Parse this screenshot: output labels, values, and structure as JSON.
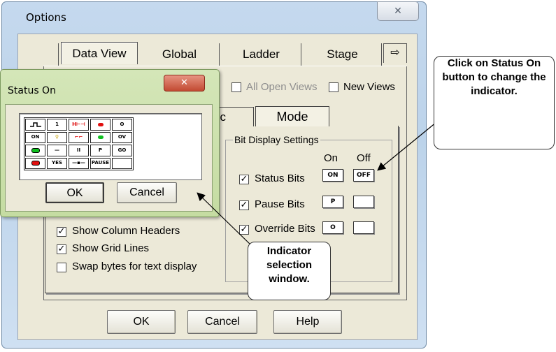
{
  "window": {
    "title": "Options",
    "close_glyph": "✕"
  },
  "tabs": [
    "Data View",
    "Global",
    "Ladder",
    "Stage"
  ],
  "tab_scroll_icon": "⇨",
  "sub_tabs": {
    "partial": "oc",
    "mode": "Mode"
  },
  "apply_to": {
    "all_open_views": "All Open Views",
    "new_views": "New Views"
  },
  "bit_display": {
    "title": "Bit Display Settings",
    "col_on": "On",
    "col_off": "Off",
    "rows": [
      {
        "label": "Status Bits",
        "on": "ON",
        "off": "OFF",
        "checked": true
      },
      {
        "label": "Pause Bits",
        "on": "P",
        "off": "",
        "checked": true
      },
      {
        "label": "Override Bits",
        "on": "O",
        "off": "",
        "checked": true
      }
    ]
  },
  "left_options": [
    {
      "label": "Show Column Headers",
      "checked": true
    },
    {
      "label": "Show Grid Lines",
      "checked": true
    },
    {
      "label": "Swap bytes for text display",
      "checked": false
    }
  ],
  "buttons": {
    "ok": "OK",
    "cancel": "Cancel",
    "help": "Help"
  },
  "status_popup": {
    "title": "Status On",
    "close_glyph": "✕",
    "ok": "OK",
    "cancel": "Cancel",
    "grid": [
      [
        "pulse-icon",
        "1",
        "⊢⊣",
        "red-dot",
        "O"
      ],
      [
        "ON",
        "bulb-icon",
        "switch-icon",
        "green-dot",
        "OV"
      ],
      [
        "green-dot",
        "—",
        "II",
        "P",
        "GO"
      ],
      [
        "red-dot",
        "YES",
        "—▪—",
        "PAUSE",
        ""
      ]
    ]
  },
  "callouts": {
    "status_on": "Click on Status On button to change the indicator.",
    "indicator_window": "Indicator selection window."
  },
  "colors": {
    "window_frame": "#bcd3ea",
    "popup_frame": "#c5dca2",
    "dialog_bg": "#ece9d8"
  }
}
